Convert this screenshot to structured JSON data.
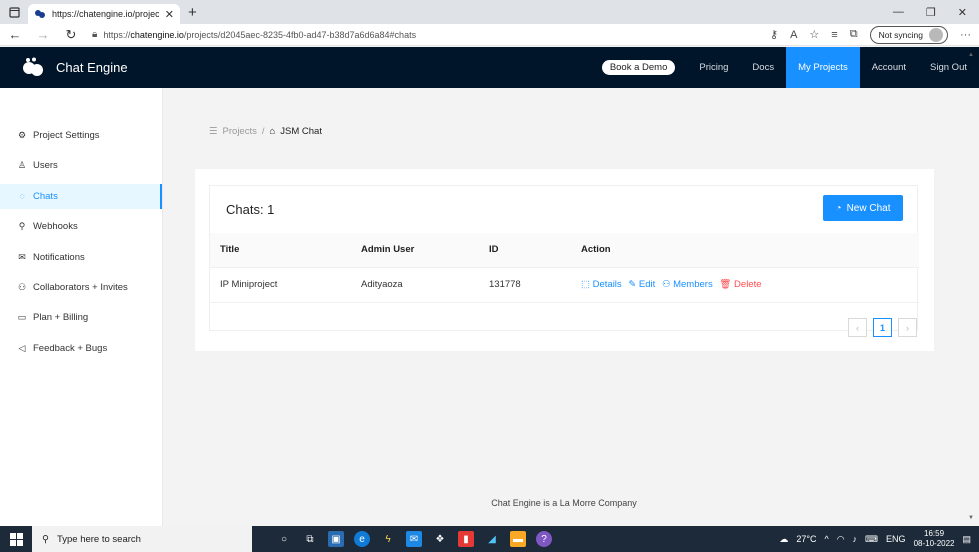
{
  "browser": {
    "tab_title": "https://chatengine.io/projects/d",
    "url_prefix": "https://",
    "url_host": "chatengine.io",
    "url_path": "/projects/d2045aec-8235-4fb0-ad47-b38d7a6d6a84#chats",
    "sync_label": "Not syncing"
  },
  "app": {
    "brand": "Chat Engine",
    "nav": {
      "book_demo": "Book a Demo",
      "pricing": "Pricing",
      "docs": "Docs",
      "my_projects": "My Projects",
      "account": "Account",
      "sign_out": "Sign Out"
    }
  },
  "sidebar": {
    "items": [
      {
        "label": "Project Settings",
        "icon": "gear-icon"
      },
      {
        "label": "Users",
        "icon": "user-icon"
      },
      {
        "label": "Chats",
        "icon": "chat-icon"
      },
      {
        "label": "Webhooks",
        "icon": "link-icon"
      },
      {
        "label": "Notifications",
        "icon": "mail-icon"
      },
      {
        "label": "Collaborators + Invites",
        "icon": "team-icon"
      },
      {
        "label": "Plan + Billing",
        "icon": "credit-card-icon"
      },
      {
        "label": "Feedback + Bugs",
        "icon": "notification-icon"
      }
    ]
  },
  "breadcrumb": {
    "parent": "Projects",
    "separator": "/",
    "current": "JSM Chat"
  },
  "chats": {
    "heading": "Chats: 1",
    "new_chat": "New Chat",
    "columns": [
      "Title",
      "Admin User",
      "ID",
      "Action"
    ],
    "rows": [
      {
        "title": "IP Miniproject",
        "admin": "Adityaoza",
        "id": "131778"
      }
    ],
    "actions": {
      "details": "Details",
      "edit": "Edit",
      "members": "Members",
      "delete": "Delete"
    },
    "page": "1"
  },
  "footer": "Chat Engine is a La Morre Company",
  "taskbar": {
    "search_placeholder": "Type here to search",
    "weather": "27°C",
    "lang": "ENG",
    "time": "16:59",
    "date": "08-10-2022"
  },
  "colors": {
    "accent": "#1890ff",
    "header": "#001529",
    "danger": "#ff4d4f"
  }
}
